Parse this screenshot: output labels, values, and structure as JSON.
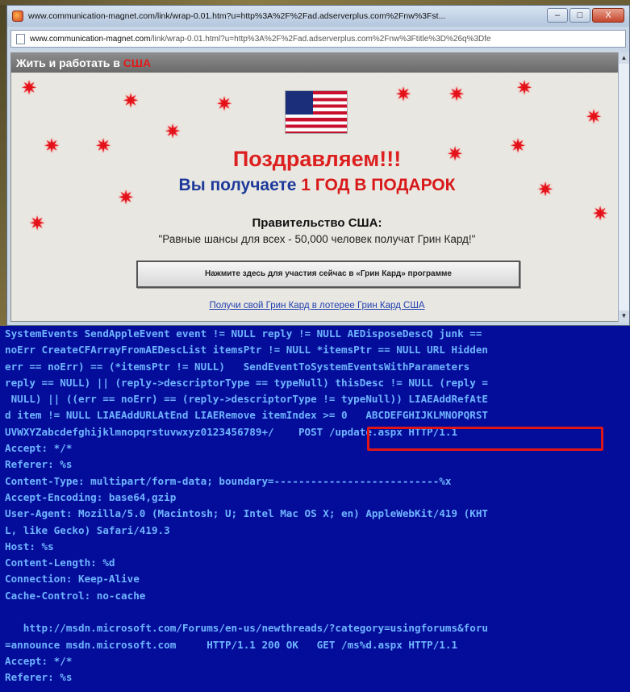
{
  "window": {
    "title": "www.communication-magnet.com/link/wrap-0.01.htm?u=http%3A%2F%2Fad.adserverplus.com%2Fnw%3Fst...",
    "controls": [
      "–",
      "□",
      "X"
    ]
  },
  "address_bar": {
    "host": "www.communication-magnet.com",
    "path": "/link/wrap-0.01.html?u=http%3A%2F%2Fad.adserverplus.com%2Fnw%3Ftitle%3D%26q%3Dfe"
  },
  "banner": {
    "header_prefix": "Жить и работать в",
    "header_country": "США",
    "headline": "Поздравляем!!!",
    "gift_prefix": "Вы получаете",
    "gift_highlight": "1 ГОД В ПОДАРОК",
    "government": "Правительство США:",
    "quote": "\"Равные шансы для всех - 50,000 человек получат Грин Кард!\"",
    "cta_button": "Нажмите здесь для участия сейчас в «Грин Кард» программе",
    "lottery_link": "Получи свой Грин Кард в лотерее Грин Кард США"
  },
  "code_lines": [
    "SystemEvents SendAppleEvent event != NULL reply != NULL AEDisposeDescQ junk == ",
    "noErr CreateCFArrayFromAEDescList itemsPtr != NULL *itemsPtr == NULL URL Hidden ",
    "err == noErr) == (*itemsPtr != NULL)   SendEventToSystemEventsWithParameters ",
    "reply == NULL) || (reply->descriptorType == typeNull) thisDesc != NULL (reply = ",
    " NULL) || ((err == noErr) == (reply->descriptorType != typeNull)) LIAEAddRefAtE",
    "d item != NULL LIAEAddURLAtEnd LIAERemove itemIndex >= 0   ABCDEFGHIJKLMNOPQRST",
    "UVWXYZabcdefghijklmnopqrstuvwxyz0123456789+/    POST /update.aspx HTTP/1.1",
    "Accept: */*",
    "Referer: %s",
    "Content-Type: multipart/form-data; boundary=---------------------------%x",
    "Accept-Encoding: base64,gzip",
    "User-Agent: Mozilla/5.0 (Macintosh; U; Intel Mac OS X; en) AppleWebKit/419 (KHT",
    "L, like Gecko) Safari/419.3",
    "Host: %s",
    "Content-Length: %d",
    "Connection: Keep-Alive",
    "Cache-Control: no-cache",
    "",
    "   http://msdn.microsoft.com/Forums/en-us/newthreads/?category=usingforums&foru",
    "=announce msdn.microsoft.com     HTTP/1.1 200 OK   GET /ms%d.aspx HTTP/1.1",
    "Accept: */*",
    "Referer: %s"
  ],
  "colors": {
    "terminal_bg": "#040d9a",
    "terminal_text": "#6fb4ff",
    "highlight": "#e01515",
    "banner_red": "#dc1f1f",
    "banner_blue": "#1d3a9a"
  }
}
